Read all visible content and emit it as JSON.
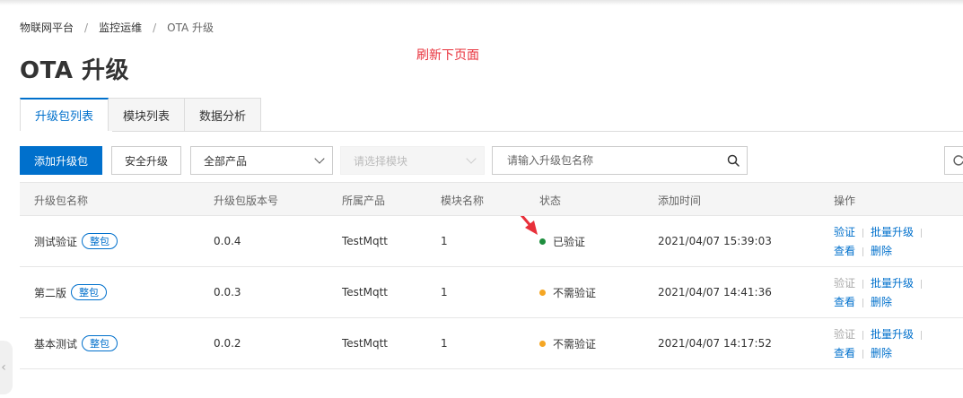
{
  "breadcrumb": {
    "items": [
      "物联网平台",
      "监控运维",
      "OTA 升级"
    ],
    "separator": "/"
  },
  "page": {
    "title": "OTA 升级"
  },
  "annotation": {
    "text": "刷新下页面",
    "color": "#e8303a"
  },
  "tabs": [
    {
      "label": "升级包列表",
      "active": true
    },
    {
      "label": "模块列表",
      "active": false
    },
    {
      "label": "数据分析",
      "active": false
    }
  ],
  "toolbar": {
    "add_label": "添加升级包",
    "secure_label": "安全升级",
    "product_select": "全部产品",
    "module_select": "请选择模块",
    "search_placeholder": "请输入升级包名称"
  },
  "table": {
    "headers": [
      "升级包名称",
      "升级包版本号",
      "所属产品",
      "模块名称",
      "状态",
      "添加时间",
      "操作"
    ],
    "rows": [
      {
        "name": "测试验证",
        "tag": "整包",
        "version": "0.0.4",
        "product": "TestMqtt",
        "module": "1",
        "status": "已验证",
        "status_color": "#1e8e3e",
        "time": "2021/04/07 15:39:03",
        "verify_enabled": true
      },
      {
        "name": "第二版",
        "tag": "整包",
        "version": "0.0.3",
        "product": "TestMqtt",
        "module": "1",
        "status": "不需验证",
        "status_color": "#f5a623",
        "time": "2021/04/07 14:41:36",
        "verify_enabled": false
      },
      {
        "name": "基本测试",
        "tag": "整包",
        "version": "0.0.2",
        "product": "TestMqtt",
        "module": "1",
        "status": "不需验证",
        "status_color": "#f5a623",
        "time": "2021/04/07 14:17:52",
        "verify_enabled": false
      }
    ],
    "actions": {
      "verify": "验证",
      "batch": "批量升级",
      "view": "查看",
      "delete": "删除"
    }
  },
  "colors": {
    "primary": "#0070cc"
  }
}
